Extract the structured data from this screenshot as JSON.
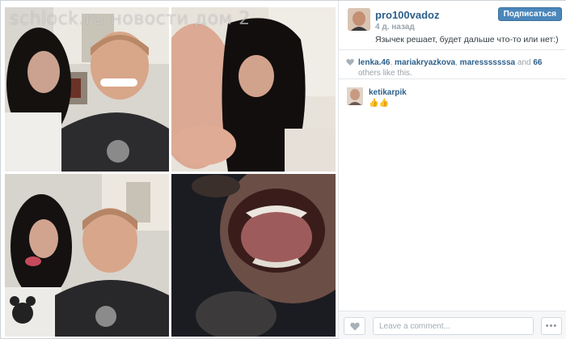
{
  "watermark": "schlock.ru    новости дом 2",
  "post": {
    "username": "pro100vadoz",
    "time_ago": "4 д. назад",
    "follow_label": "Подписаться",
    "caption": "Язычек решает, будет дальше что-то или нет:)"
  },
  "likes": {
    "users": [
      "lenka.46",
      "mariakryazkova",
      "maresssssssa"
    ],
    "separator": ", ",
    "and_label": " and ",
    "others_count": "66",
    "others_suffix": " others like this."
  },
  "comments": [
    {
      "username": "ketikarpik",
      "text": "👍👍"
    }
  ],
  "footer": {
    "comment_placeholder": "Leave a comment...",
    "more_label": "•••"
  },
  "icons": {
    "like": "heart-icon",
    "more": "ellipsis-icon"
  },
  "colors": {
    "link": "#2c5f8a",
    "follow_button": "#4a87bb",
    "muted": "#9aa3ab"
  }
}
